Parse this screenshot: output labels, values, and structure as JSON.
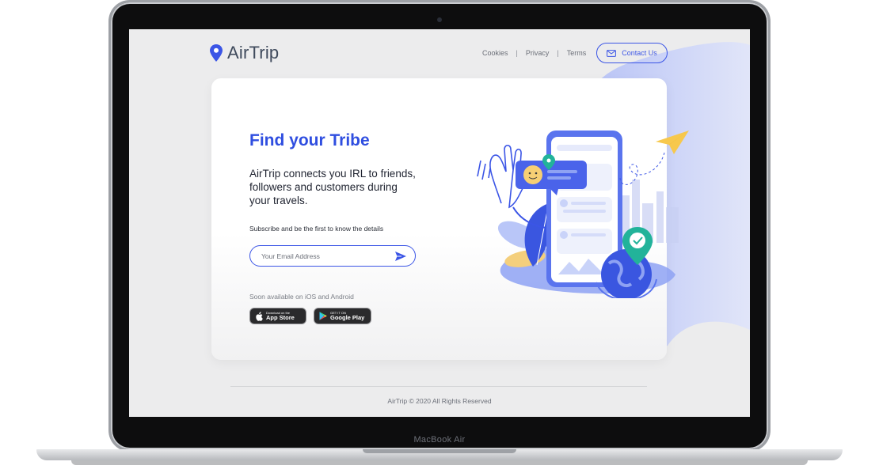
{
  "device": {
    "model_label": "MacBook Air"
  },
  "header": {
    "logo_text": "AirTrip",
    "nav_links": [
      "Cookies",
      "Privacy",
      "Terms"
    ],
    "nav_separator": "|",
    "contact_label": "Contact Us"
  },
  "hero": {
    "title": "Find your Tribe",
    "description": "AirTrip connects you IRL to friends, followers and customers during your travels.",
    "subscribe_label": "Subscribe and be the first to know the details",
    "email_placeholder": "Your Email Address",
    "availability_text": "Soon available on iOS and Android",
    "app_store": {
      "top": "Download on the",
      "bottom": "App Store"
    },
    "google_play": {
      "top": "GET IT ON",
      "bottom": "Google Play"
    }
  },
  "footer": {
    "copyright": "AirTrip © 2020 All Rights Reserved"
  },
  "colors": {
    "accent": "#3b55e6",
    "title": "#2f4ee0",
    "illustration": "#7f95f0",
    "check_badge": "#22b39a"
  }
}
